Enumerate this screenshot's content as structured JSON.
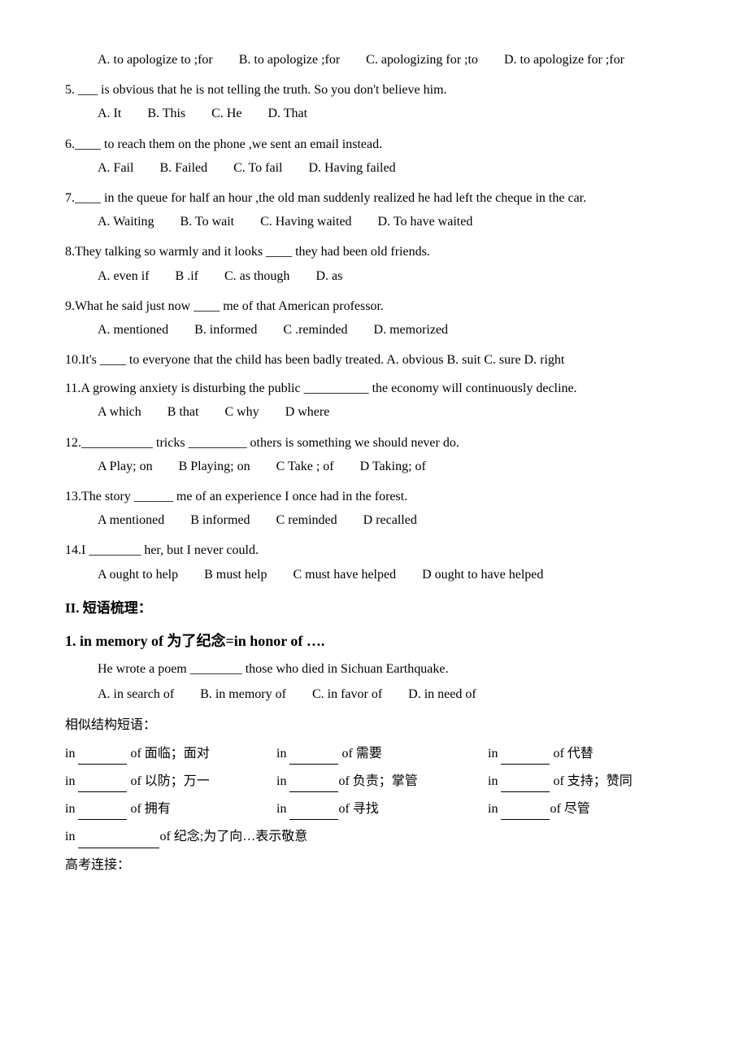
{
  "questions": [
    {
      "id": "q4_options",
      "text": "",
      "options": [
        "A. to apologize to ;for",
        "B. to apologize ;for",
        "C. apologizing for ;to",
        "D. to apologize for ;for"
      ]
    },
    {
      "id": "q5",
      "text": "5. ___ is obvious that he is not telling the truth. So you don't believe him.",
      "options": [
        "A. It",
        "B. This",
        "C. He",
        "D. That"
      ]
    },
    {
      "id": "q6",
      "text": "6.____ to reach them on the phone ,we sent an email instead.",
      "options": [
        "A. Fail",
        "B. Failed",
        "C. To fail",
        "D. Having failed"
      ]
    },
    {
      "id": "q7",
      "text": "7.____ in the queue for half an hour ,the old man suddenly realized he had left the cheque in the car.",
      "options": [
        "A. Waiting",
        "B. To wait",
        "C. Having waited",
        "D. To have waited"
      ]
    },
    {
      "id": "q8",
      "text": "8.They talking so warmly and it looks ____ they had been old friends.",
      "options": [
        "A. even if",
        "B .if",
        "C. as though",
        "D. as"
      ]
    },
    {
      "id": "q9",
      "text": "9.What he said just now ____ me of that American professor.",
      "options": [
        "A. mentioned",
        "B. informed",
        "C .reminded",
        "D. memorized"
      ]
    },
    {
      "id": "q10",
      "text": "10.It's ____ to everyone that the child has been badly treated. A. obvious B. suit C. sure D. right"
    },
    {
      "id": "q11",
      "text": "11.A growing anxiety is disturbing the public __________ the economy will continuously decline.",
      "options": [
        "A which",
        "B that",
        "C why",
        "D where"
      ]
    },
    {
      "id": "q12",
      "text": "12.___________ tricks _________ others is something we should never do.",
      "options": [
        "A   Play; on",
        "B Playing; on",
        "C Take ; of",
        "D Taking; of"
      ]
    },
    {
      "id": "q13",
      "text": "13.The story ______ me of an experience I once had in the forest.",
      "options": [
        "A mentioned",
        "B informed",
        "C reminded",
        "D recalled"
      ]
    },
    {
      "id": "q14",
      "text": "14.I ________ her, but I never could.",
      "options": [
        "A ought to help",
        "B must help",
        "C must have helped",
        "D ought to have helped"
      ]
    }
  ],
  "section2": {
    "header": "II. 短语梳理：",
    "phrase1": {
      "title": "1. in memory of   为了纪念=in honor of ….",
      "example": "He wrote a poem ________ those who died in Sichuan Earthquake.",
      "options": [
        "A. in search of",
        "B. in memory of",
        "C. in favor of",
        "D. in need of"
      ],
      "similar_label": "相似结构短语：",
      "grid": [
        {
          "blank": "",
          "meaning": "面临；面对",
          "col": 1
        },
        {
          "blank": "",
          "meaning": "需要",
          "col": 2
        },
        {
          "blank": "",
          "meaning": "代替",
          "col": 3
        },
        {
          "blank": "",
          "meaning": "以防；万一",
          "col": 1
        },
        {
          "blank": "",
          "meaning": "负责；掌管",
          "col": 2
        },
        {
          "blank": "",
          "meaning": "支持；赞同",
          "col": 3
        },
        {
          "blank": "",
          "meaning": "拥有",
          "col": 1
        },
        {
          "blank": "",
          "meaning": "寻找",
          "col": 2
        },
        {
          "blank": "",
          "meaning": "尽管",
          "col": 3
        },
        {
          "blank_long": "",
          "meaning": "纪念;为了向…表示敬意",
          "col": 1
        }
      ],
      "gaokao": "高考连接："
    }
  }
}
